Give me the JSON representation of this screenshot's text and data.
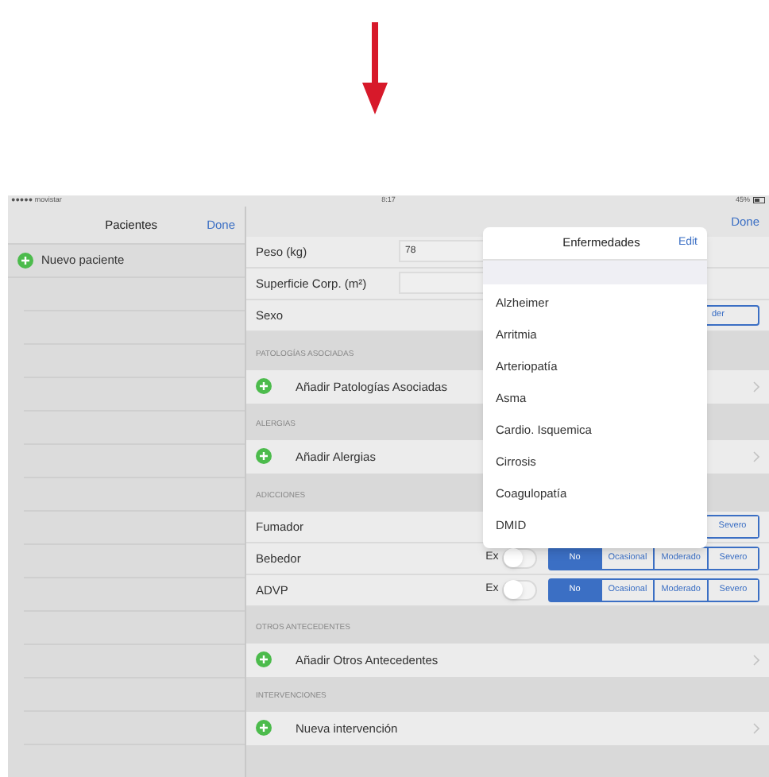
{
  "status_bar": {
    "carrier": "●●●●● movistar",
    "time": "8:17",
    "battery": "45%"
  },
  "sidebar": {
    "title": "Pacientes",
    "done": "Done",
    "items": [
      {
        "label": "Nuevo paciente"
      }
    ]
  },
  "detail": {
    "done": "Done",
    "fields": [
      {
        "label": "Peso (kg)",
        "value": "78",
        "kind": "input"
      },
      {
        "label": "Superficie Corp. (m²)",
        "kind": "input"
      },
      {
        "label": "Sexo",
        "kind": "segment",
        "button": "der"
      }
    ],
    "sections": [
      {
        "title": "PATOLOGÍAS ASOCIADAS",
        "rows": [
          {
            "kind": "add",
            "label": "Añadir Patologías Asociadas"
          }
        ]
      },
      {
        "title": "ALERGIAS",
        "rows": [
          {
            "kind": "add",
            "label": "Añadir Alergias"
          }
        ]
      },
      {
        "title": "ADICCIONES",
        "rows": [
          {
            "kind": "addiction",
            "label": "Fumador",
            "options": [
              {
                "label": "Severo",
                "selected": false
              }
            ]
          },
          {
            "kind": "addiction",
            "label": "Bebedor",
            "ex": {
              "label": "Ex",
              "on": false
            },
            "options": [
              {
                "label": "No",
                "selected": true
              },
              {
                "label": "Ocasional",
                "selected": false
              },
              {
                "label": "Moderado",
                "selected": false
              },
              {
                "label": "Severo",
                "selected": false
              }
            ]
          },
          {
            "kind": "addiction",
            "label": "ADVP",
            "ex": {
              "label": "Ex",
              "on": false
            },
            "options": [
              {
                "label": "No",
                "selected": true
              },
              {
                "label": "Ocasional",
                "selected": false
              },
              {
                "label": "Moderado",
                "selected": false
              },
              {
                "label": "Severo",
                "selected": false
              }
            ]
          }
        ]
      },
      {
        "title": "OTROS ANTECEDENTES",
        "rows": [
          {
            "kind": "add",
            "label": "Añadir Otros Antecedentes"
          }
        ]
      },
      {
        "title": "INTERVENCIONES",
        "rows": [
          {
            "kind": "add",
            "label": "Nueva intervención"
          }
        ]
      }
    ]
  },
  "popover": {
    "title": "Enfermedades",
    "edit": "Edit",
    "items": [
      "Alzheimer",
      "Arritmia",
      "Arteriopatía",
      "Asma",
      "Cardio. Isquemica",
      "Cirrosis",
      "Coagulopatía",
      "DMID"
    ]
  }
}
